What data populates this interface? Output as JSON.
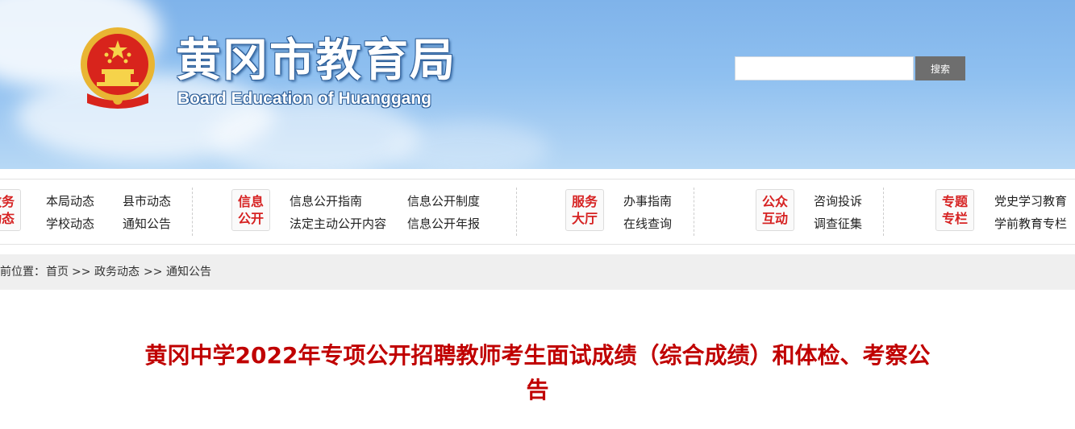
{
  "header": {
    "title": "黄冈市教育局",
    "subtitle": "Board Education of Huanggang",
    "emblem_icon": "national-emblem-icon",
    "search": {
      "value": "",
      "placeholder": "",
      "button_label": "搜索"
    }
  },
  "nav": {
    "groups": [
      {
        "badge": [
          "政务",
          "动态"
        ],
        "links": [
          "本局动态",
          "县市动态",
          "学校动态",
          "通知公告"
        ]
      },
      {
        "badge": [
          "信息",
          "公开"
        ],
        "links": [
          "信息公开指南",
          "信息公开制度",
          "法定主动公开内容",
          "信息公开年报"
        ]
      },
      {
        "badge": [
          "服务",
          "大厅"
        ],
        "links": [
          "办事指南",
          "在线查询"
        ]
      },
      {
        "badge": [
          "公众",
          "互动"
        ],
        "links": [
          "咨询投诉",
          "调查征集"
        ]
      },
      {
        "badge": [
          "专题",
          "专栏"
        ],
        "links": [
          "党史学习教育",
          "学前教育专栏"
        ]
      }
    ]
  },
  "breadcrumb": {
    "prefix": "当前位置：",
    "items": [
      "首页",
      "政务动态",
      "通知公告"
    ],
    "separator": ">>"
  },
  "article": {
    "title_line1": "黄冈中学2022年专项公开招聘教师考生面试成绩（综合成绩）和体检、考察公",
    "title_line2": "告"
  },
  "colors": {
    "accent_red": "#c00000",
    "badge_red": "#d62222",
    "search_button": "#6e6e6e"
  }
}
